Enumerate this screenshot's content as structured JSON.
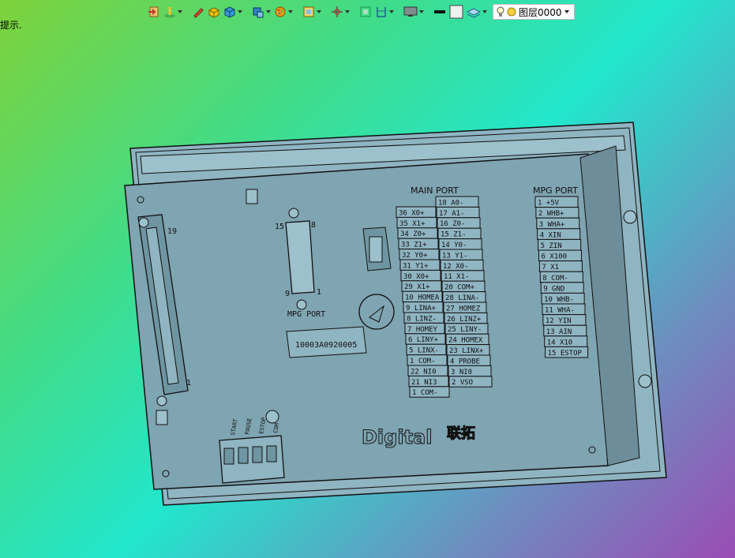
{
  "hint": {
    "text": "提示."
  },
  "toolbar": {
    "icons": [
      "import-icon",
      "light-icon",
      "pencil-icon",
      "cube-yellow-icon",
      "cube-blue-icon",
      "cube-view-icon",
      "sun-palette-icon",
      "frame-icon",
      "move-icon",
      "box-select-icon",
      "section-icon",
      "display-mode-icon",
      "line-icon",
      "color-square-icon",
      "layers-icon"
    ],
    "layer_name": "图层0000"
  },
  "device": {
    "main_port_title": "MAIN PORT",
    "mpg_port_title": "MPG PORT",
    "mpg_port_label": "MPG PORT",
    "serial_label": "10003A0920005",
    "brand": "Digital",
    "brand_cn": "联拓",
    "db15_pins": {
      "top_left": "15",
      "top_right": "8",
      "bottom_left": "9",
      "bottom_right": "1"
    },
    "db25_pins": {
      "top": "19",
      "bottom": "1"
    },
    "terminal_labels": [
      "START",
      "PAUSE",
      "ESTOP",
      "COM"
    ],
    "main_left": [
      "36 X0+",
      "35 X1+",
      "34 Z0+",
      "33 Z1+",
      "32 Y0+",
      "31 Y1+",
      "30 X0+",
      "29 X1+",
      "10 HOMEA",
      "9 LINA+",
      "8 LINZ-",
      "7 HOMEY",
      "6 LINY+",
      "5 LINX-",
      "1 COM-",
      "22 NI0",
      "21 NI3",
      "1 COM-"
    ],
    "main_right": [
      "18 A0-",
      "17 A1-",
      "16 Z0-",
      "15 Z1-",
      "14 Y0-",
      "13 Y1-",
      "12 X0-",
      "11 X1-",
      "20 COM+",
      "28 LINA-",
      "27 HOMEZ",
      "26 LINZ+",
      "25 LINY-",
      "24 HOMEX",
      "23 LINX+",
      "4 PROBE",
      "3 NI0",
      "2 VSO"
    ],
    "mpg_rows": [
      "1 +5V",
      "2 WHB+",
      "3 WHA+",
      "4 XIN",
      "5 ZIN",
      "6 X100",
      "7 X1",
      "8 COM-",
      "9 GND",
      "10 WHB-",
      "11 WHA-",
      "12 YIN",
      "13 AIN",
      "14 X10",
      "15 ESTOP"
    ]
  },
  "colors": {
    "device_body": "#7aa0ae",
    "device_edge": "#1a1a1a",
    "toolbar_bg": "#ffffff"
  }
}
